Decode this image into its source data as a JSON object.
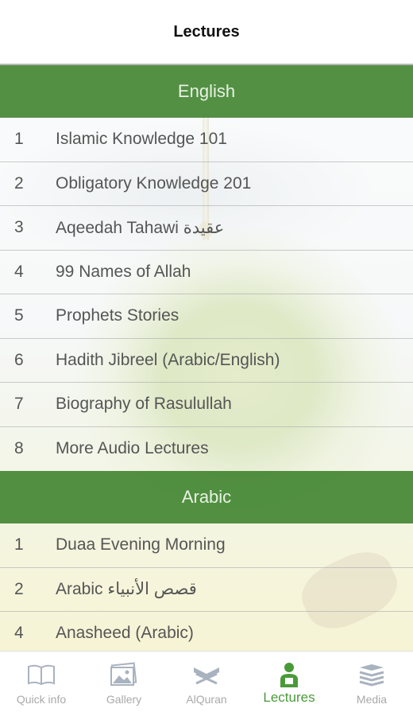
{
  "header": {
    "title": "Lectures"
  },
  "sections": [
    {
      "title": "English",
      "items": [
        {
          "num": "1",
          "title": "Islamic Knowledge 101"
        },
        {
          "num": "2",
          "title": "Obligatory Knowledge 201"
        },
        {
          "num": "3",
          "title": "Aqeedah Tahawi عقيدة"
        },
        {
          "num": "4",
          "title": "99 Names of Allah"
        },
        {
          "num": "5",
          "title": "Prophets Stories"
        },
        {
          "num": "6",
          "title": "Hadith Jibreel (Arabic/English)"
        },
        {
          "num": "7",
          "title": "Biography of Rasulullah"
        },
        {
          "num": "8",
          "title": "More Audio Lectures"
        }
      ]
    },
    {
      "title": "Arabic",
      "items": [
        {
          "num": "1",
          "title": "Duaa Evening Morning"
        },
        {
          "num": "2",
          "title": "Arabic قصص الأنبياء"
        },
        {
          "num": "4",
          "title": "Anasheed (Arabic)"
        }
      ]
    }
  ],
  "tabbar": {
    "active_color": "#4a9a3a",
    "inactive_color": "#a9a9a9",
    "tabs": [
      {
        "label": "Quick info",
        "icon": "book-icon"
      },
      {
        "label": "Gallery",
        "icon": "gallery-icon"
      },
      {
        "label": "AlQuran",
        "icon": "quran-stand-icon"
      },
      {
        "label": "Lectures",
        "icon": "lecturer-icon",
        "active": true
      },
      {
        "label": "Media",
        "icon": "media-stack-icon"
      }
    ]
  }
}
